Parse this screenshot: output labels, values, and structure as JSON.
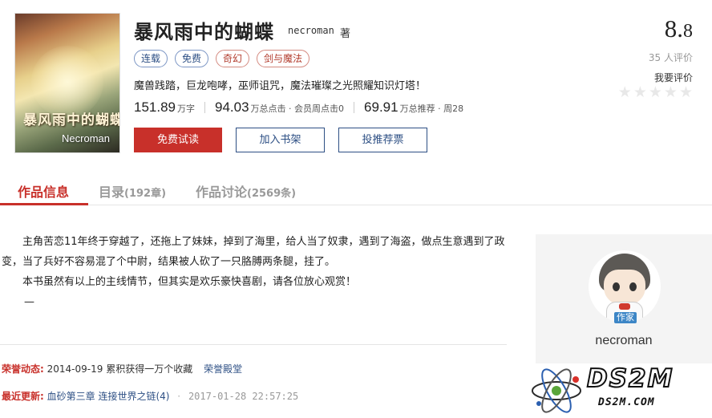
{
  "book": {
    "cover_title": "暴风雨中的蝴蝶",
    "cover_author": "Necroman",
    "title": "暴风雨中的蝴蝶",
    "author": "necroman",
    "author_suffix": "著",
    "tags": [
      {
        "label": "连载",
        "color": "blue"
      },
      {
        "label": "免费",
        "color": "blue"
      },
      {
        "label": "奇幻",
        "color": "red"
      },
      {
        "label": "剑与魔法",
        "color": "red"
      }
    ],
    "intro": "魔兽践踏，巨龙咆哮，巫师诅咒，魔法璀璨之光照耀知识灯塔！",
    "stats": {
      "words_num": "151.89",
      "words_unit": "万字",
      "clicks_num": "94.03",
      "clicks_unit": "万总点击 · 会员周点击0",
      "recommend_num": "69.91",
      "recommend_unit": "万总推荐 · 周28"
    },
    "buttons": {
      "trial": "免费试读",
      "shelf": "加入书架",
      "vote": "投推荐票"
    }
  },
  "rating": {
    "score_int": "8.",
    "score_dec": "8",
    "raters": "35 人评价",
    "rate_link": "我要评价",
    "stars_filled": 0,
    "stars_total": 5
  },
  "tabs": [
    {
      "label": "作品信息",
      "count": "",
      "active": true
    },
    {
      "label": "目录",
      "count": "(192章)",
      "active": false
    },
    {
      "label": "作品讨论",
      "count": "(2569条)",
      "active": false
    }
  ],
  "description": {
    "p1": "主角苦恋11年终于穿越了，还拖上了妹妹，掉到了海里，给人当了奴隶，遇到了海盗，做点生意遇到了政变，当了兵好不容易混了个中尉，结果被人砍了一只胳膊两条腿，挂了。",
    "p2": "本书虽然有以上的主线情节，但其实是欢乐豪快喜剧，请各位放心观赏！",
    "p3": "—"
  },
  "honor": {
    "label": "荣誉动态:",
    "date": "2014-09-19",
    "text": "累积获得一万个收藏",
    "link": "荣誉殿堂"
  },
  "latest": {
    "label": "最近更新:",
    "chapter": "血砂第三章 连接世界之链(4)",
    "dot": "·",
    "time": "2017-01-28 22:57:25"
  },
  "author_box": {
    "badge": "作家",
    "name": "necroman"
  },
  "watermark": {
    "big": "DS2M",
    "small": "DS2M.COM"
  },
  "colors": {
    "accent_red": "#c8302a",
    "link_blue": "#2d4f84"
  }
}
